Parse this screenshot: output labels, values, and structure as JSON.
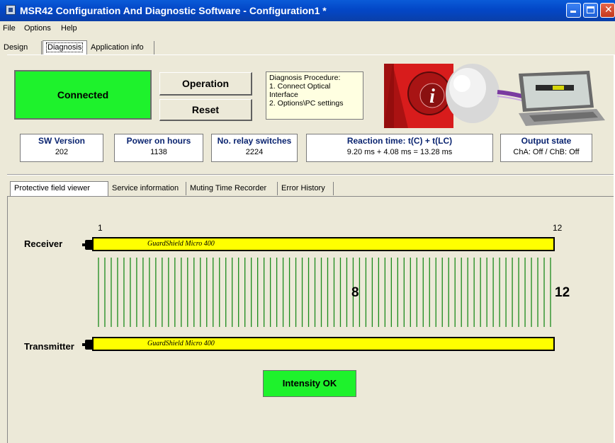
{
  "window": {
    "title": "MSR42 Configuration And Diagnostic Software - Configuration1 *"
  },
  "menu": [
    "File",
    "Options",
    "Help"
  ],
  "main_tabs": [
    {
      "label": "Design",
      "active": false
    },
    {
      "label": "Diagnosis",
      "active": true
    },
    {
      "label": "Application info",
      "active": false
    }
  ],
  "diagnosis": {
    "status": "Connected",
    "status_color": "#1ef22c",
    "operation_label": "Operation",
    "reset_label": "Reset",
    "procedure": {
      "title": "Diagnosis Procedure:",
      "step1": "1. Connect Optical",
      "step1b": "Interface",
      "step2": "2. Options\\PC settings"
    },
    "info": [
      {
        "heading": "SW Version",
        "value": "202"
      },
      {
        "heading": "Power on hours",
        "value": "1138"
      },
      {
        "heading": "No. relay switches",
        "value": "2224"
      },
      {
        "heading": "Reaction time: t(C) + t(LC)",
        "value": "9.20 ms + 4.08 ms = 13.28 ms"
      },
      {
        "heading": "Output state",
        "value": "ChA: Off / ChB: Off"
      }
    ]
  },
  "sub_tabs": [
    {
      "label": "Protective field viewer",
      "active": true
    },
    {
      "label": "Service information",
      "active": false
    },
    {
      "label": "Muting Time Recorder",
      "active": false
    },
    {
      "label": "Error History",
      "active": false
    }
  ],
  "viewer": {
    "receiver_label": "Receiver",
    "transmitter_label": "Transmitter",
    "device_name": "GuardShield Micro 400",
    "start_index": "1",
    "end_index": "12",
    "blocked_count": "8",
    "total_count": "12",
    "beam_color": "#1a8a1a",
    "bar_color": "#ffff00",
    "intensity": "Intensity OK"
  }
}
